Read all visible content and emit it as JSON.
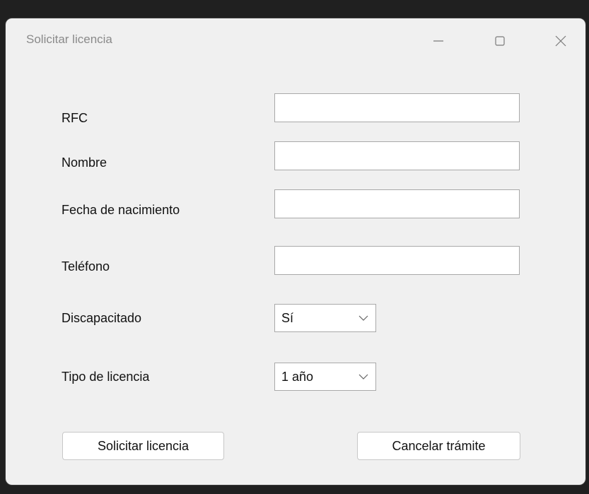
{
  "window": {
    "title": "Solicitar licencia",
    "controls": {
      "minimize": "minimize-icon",
      "maximize": "maximize-icon",
      "close": "close-icon"
    }
  },
  "form": {
    "rfc": {
      "label": "RFC",
      "value": ""
    },
    "nombre": {
      "label": "Nombre",
      "value": ""
    },
    "fecha_nacimiento": {
      "label": "Fecha de nacimiento",
      "value": ""
    },
    "telefono": {
      "label": "Teléfono",
      "value": ""
    },
    "discapacitado": {
      "label": "Discapacitado",
      "selected": "Sí"
    },
    "tipo_licencia": {
      "label": "Tipo de licencia",
      "selected": "1 año"
    }
  },
  "buttons": {
    "solicitar": "Solicitar licencia",
    "cancelar": "Cancelar trámite"
  },
  "colors": {
    "window_bg": "#f0f0f0",
    "frame_bg": "#202020",
    "title_text": "#8a8a8a",
    "field_border": "#a9a9a9"
  }
}
